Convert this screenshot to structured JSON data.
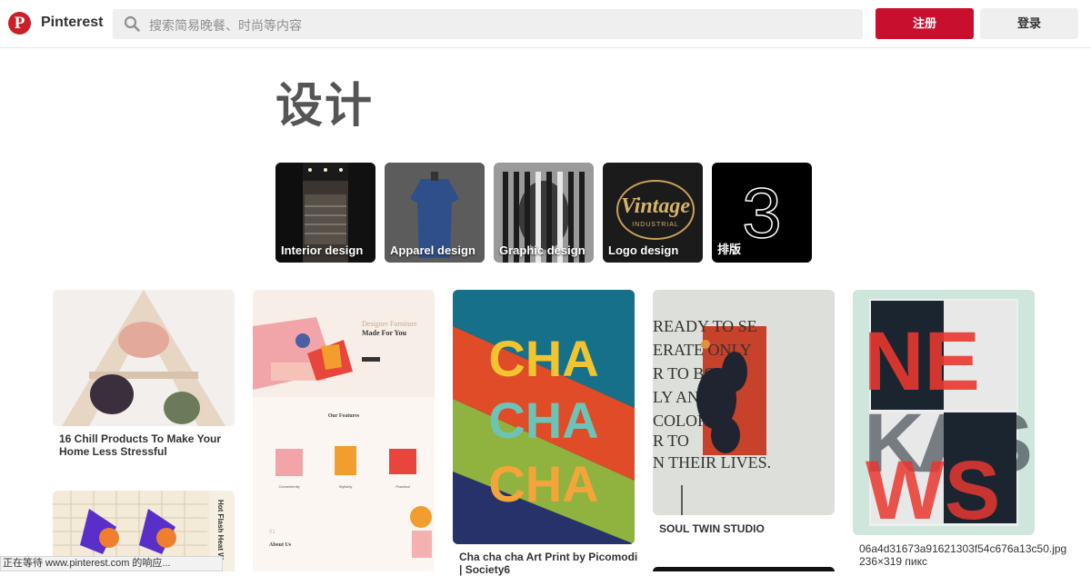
{
  "header": {
    "brand": "Pinterest",
    "search_placeholder": "搜索简易晚餐、时尚等内容",
    "signup_label": "注册",
    "login_label": "登录"
  },
  "page": {
    "title": "设计"
  },
  "categories": [
    {
      "label": "Interior design"
    },
    {
      "label": "Apparel design"
    },
    {
      "label": "Graphic design"
    },
    {
      "label": "Logo design"
    },
    {
      "label": "排版"
    }
  ],
  "pins": {
    "col1_pin1_caption": "16 Chill Products To Make Your Home Less Stressful",
    "col2_pin1_text": {
      "heading": "Designer Furniture",
      "subheading": "Made For You",
      "features": "Our Features",
      "f1": "Conveniently",
      "f2": "Stylishly",
      "f3": "Practical",
      "about": "About Us",
      "num": "01"
    },
    "col3_pin1_caption": "Cha cha cha Art Print by Picomodi | Society6",
    "col3_pin1_art": [
      "CHA",
      "CHA",
      "CHA"
    ],
    "col4_pin1_caption": "SOUL TWIN STUDIO",
    "col4_pin1_art": [
      "READY TO SE",
      "ERATE ONLY",
      "R TO BOBY",
      "LY AND",
      "COLOR",
      "R TO",
      "N THEIR LIVES."
    ],
    "col5_pin1_caption": "06a4d31673a91621303f54c676a13c50.jpg 236×319 пикс",
    "col5_pin1_art": [
      "NE",
      "AS",
      "KA",
      "WS"
    ],
    "col1_pin2_side": "Hot Flash Heat Wave"
  },
  "logo_art": {
    "word": "Vintage",
    "sub": "INDUSTRIAL",
    "digit": "3"
  },
  "status": {
    "text": "正在等待 www.pinterest.com 的响应..."
  },
  "colors": {
    "brand_red": "#c8102e",
    "button_gray": "#efefef"
  }
}
